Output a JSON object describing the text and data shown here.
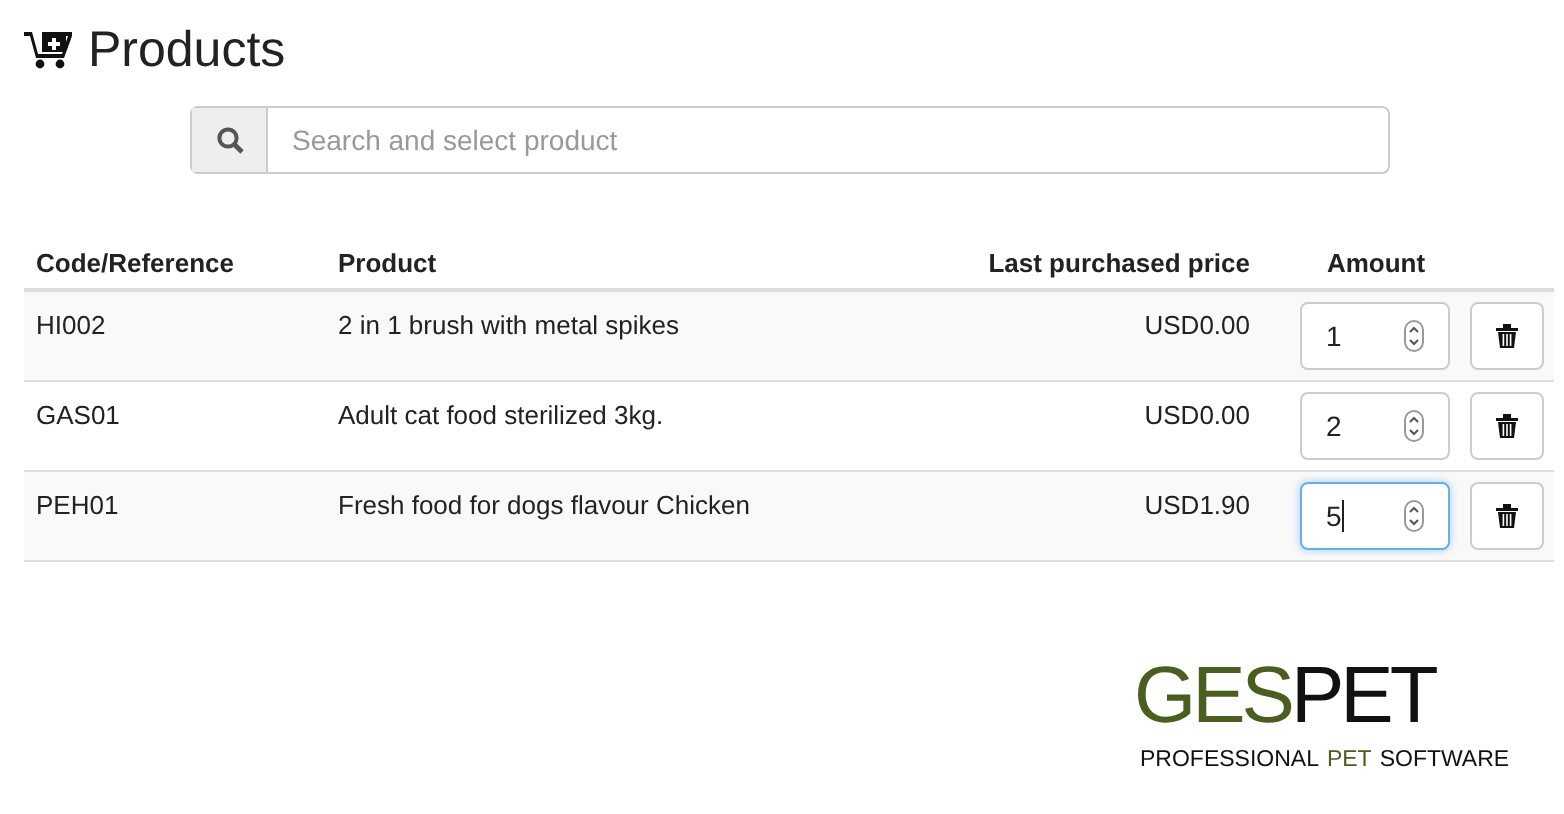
{
  "title": "Products",
  "search": {
    "placeholder": "Search and select product"
  },
  "table": {
    "columns": [
      "Code/Reference",
      "Product",
      "Last purchased price",
      "Amount"
    ],
    "rows": [
      {
        "code": "HI002",
        "product": "2 in 1 brush with metal spikes",
        "price": "USD0.00",
        "amount": "1",
        "focused": false
      },
      {
        "code": "GAS01",
        "product": "Adult cat food sterilized 3kg.",
        "price": "USD0.00",
        "amount": "2",
        "focused": false
      },
      {
        "code": "PEH01",
        "product": "Fresh food for dogs flavour Chicken",
        "price": "USD1.90",
        "amount": "5",
        "focused": true
      }
    ]
  },
  "logo": {
    "name_parts": [
      {
        "text": "GES",
        "color": "#4a5e1f"
      },
      {
        "text": "PET",
        "color": "#111111"
      }
    ],
    "tagline_parts": [
      {
        "text": "PROFESSIONAL",
        "color": "#111111"
      },
      {
        "text": "PET",
        "color": "#4a5e1f"
      },
      {
        "text": "SOFTWARE",
        "color": "#111111"
      }
    ]
  }
}
